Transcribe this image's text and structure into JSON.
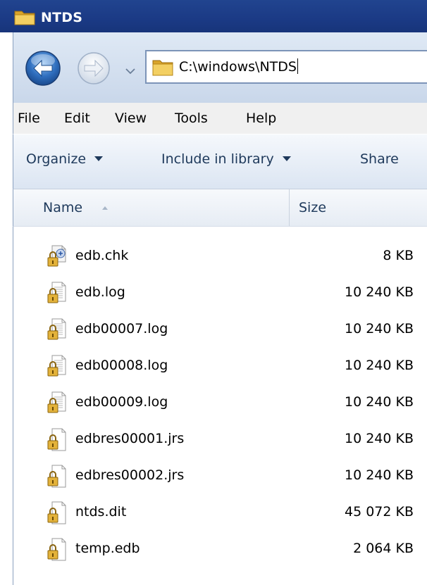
{
  "window": {
    "title": "NTDS"
  },
  "address": {
    "path": "C:\\windows\\NTDS"
  },
  "menu": [
    "File",
    "Edit",
    "View",
    "Tools",
    "Help"
  ],
  "commands": {
    "organize": "Organize",
    "include_in_library": "Include in library",
    "share": "Share"
  },
  "columns": {
    "name": "Name",
    "size": "Size"
  },
  "files": [
    {
      "name": "edb.chk",
      "size": "8 KB",
      "icon": "chk-file-lock-icon"
    },
    {
      "name": "edb.log",
      "size": "10 240 KB",
      "icon": "text-file-lock-icon"
    },
    {
      "name": "edb00007.log",
      "size": "10 240 KB",
      "icon": "text-file-lock-icon"
    },
    {
      "name": "edb00008.log",
      "size": "10 240 KB",
      "icon": "text-file-lock-icon"
    },
    {
      "name": "edb00009.log",
      "size": "10 240 KB",
      "icon": "text-file-lock-icon"
    },
    {
      "name": "edbres00001.jrs",
      "size": "10 240 KB",
      "icon": "blank-file-lock-icon"
    },
    {
      "name": "edbres00002.jrs",
      "size": "10 240 KB",
      "icon": "blank-file-lock-icon"
    },
    {
      "name": "ntds.dit",
      "size": "45 072 KB",
      "icon": "blank-file-lock-icon"
    },
    {
      "name": "temp.edb",
      "size": "2 064 KB",
      "icon": "blank-file-lock-icon"
    }
  ],
  "colors": {
    "titlebar": "#1b3a85",
    "command_text": "#1e395b",
    "folder": "#e8b53a"
  }
}
